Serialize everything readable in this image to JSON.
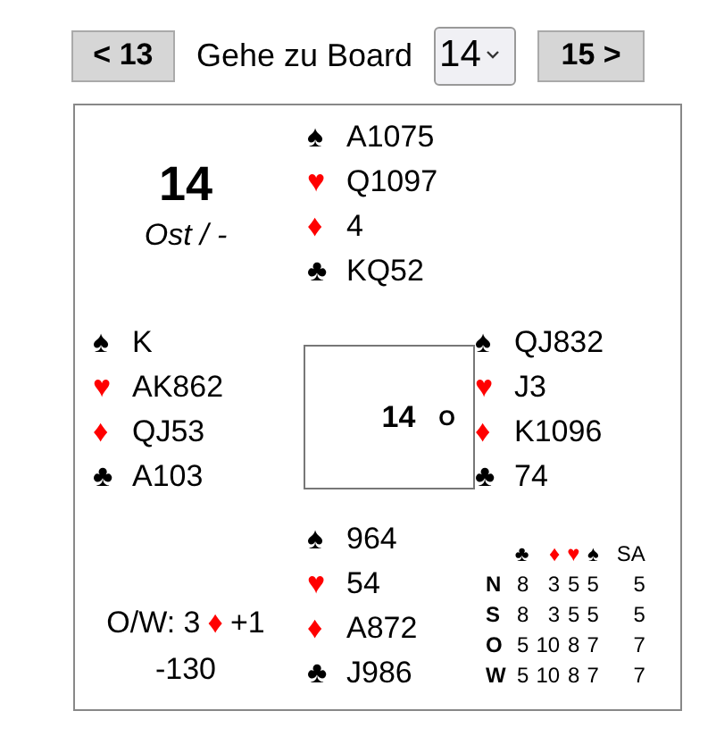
{
  "nav": {
    "prev_button": "< 13",
    "label": "Gehe zu Board",
    "board_select": "14",
    "next_button": "15 >"
  },
  "board_info": {
    "number": "14",
    "dealer_vulnerability": "Ost / -"
  },
  "north": [
    {
      "kind": "spades",
      "symbol": "♠",
      "cards": "A1075"
    },
    {
      "kind": "hearts",
      "symbol": "♥",
      "cards": "Q1097"
    },
    {
      "kind": "diamonds",
      "symbol": "♦",
      "cards": "4"
    },
    {
      "kind": "clubs",
      "symbol": "♣",
      "cards": "KQ52"
    }
  ],
  "west": [
    {
      "kind": "spades",
      "symbol": "♠",
      "cards": "K"
    },
    {
      "kind": "hearts",
      "symbol": "♥",
      "cards": "AK862"
    },
    {
      "kind": "diamonds",
      "symbol": "♦",
      "cards": "QJ53"
    },
    {
      "kind": "clubs",
      "symbol": "♣",
      "cards": "A103"
    }
  ],
  "center": {
    "number": "14",
    "dealer": "O"
  },
  "east": [
    {
      "kind": "spades",
      "symbol": "♠",
      "cards": "QJ832"
    },
    {
      "kind": "hearts",
      "symbol": "♥",
      "cards": "J3"
    },
    {
      "kind": "diamonds",
      "symbol": "♦",
      "cards": "K1096"
    },
    {
      "kind": "clubs",
      "symbol": "♣",
      "cards": "74"
    }
  ],
  "south": [
    {
      "kind": "spades",
      "symbol": "♠",
      "cards": "964"
    },
    {
      "kind": "hearts",
      "symbol": "♥",
      "cards": "54"
    },
    {
      "kind": "diamonds",
      "symbol": "♦",
      "cards": "A872"
    },
    {
      "kind": "clubs",
      "symbol": "♣",
      "cards": "J986"
    }
  ],
  "contract": {
    "side_level": "O/W: 3",
    "suit": {
      "kind": "diamonds",
      "symbol": "♦"
    },
    "result": "+1",
    "score": "-130"
  },
  "par_table": {
    "columns": [
      {
        "kind": "clubs",
        "symbol": "♣"
      },
      {
        "kind": "diamonds",
        "symbol": "♦"
      },
      {
        "kind": "hearts",
        "symbol": "♥"
      },
      {
        "kind": "spades",
        "symbol": "♠"
      },
      {
        "kind": "notrump",
        "symbol": "SA"
      }
    ],
    "rows": [
      {
        "player": "N",
        "tricks": [
          "8",
          "3",
          "5",
          "5",
          "5"
        ]
      },
      {
        "player": "S",
        "tricks": [
          "8",
          "3",
          "5",
          "5",
          "5"
        ]
      },
      {
        "player": "O",
        "tricks": [
          "5",
          "10",
          "8",
          "7",
          "7"
        ]
      },
      {
        "player": "W",
        "tricks": [
          "5",
          "10",
          "8",
          "7",
          "7"
        ]
      }
    ]
  }
}
